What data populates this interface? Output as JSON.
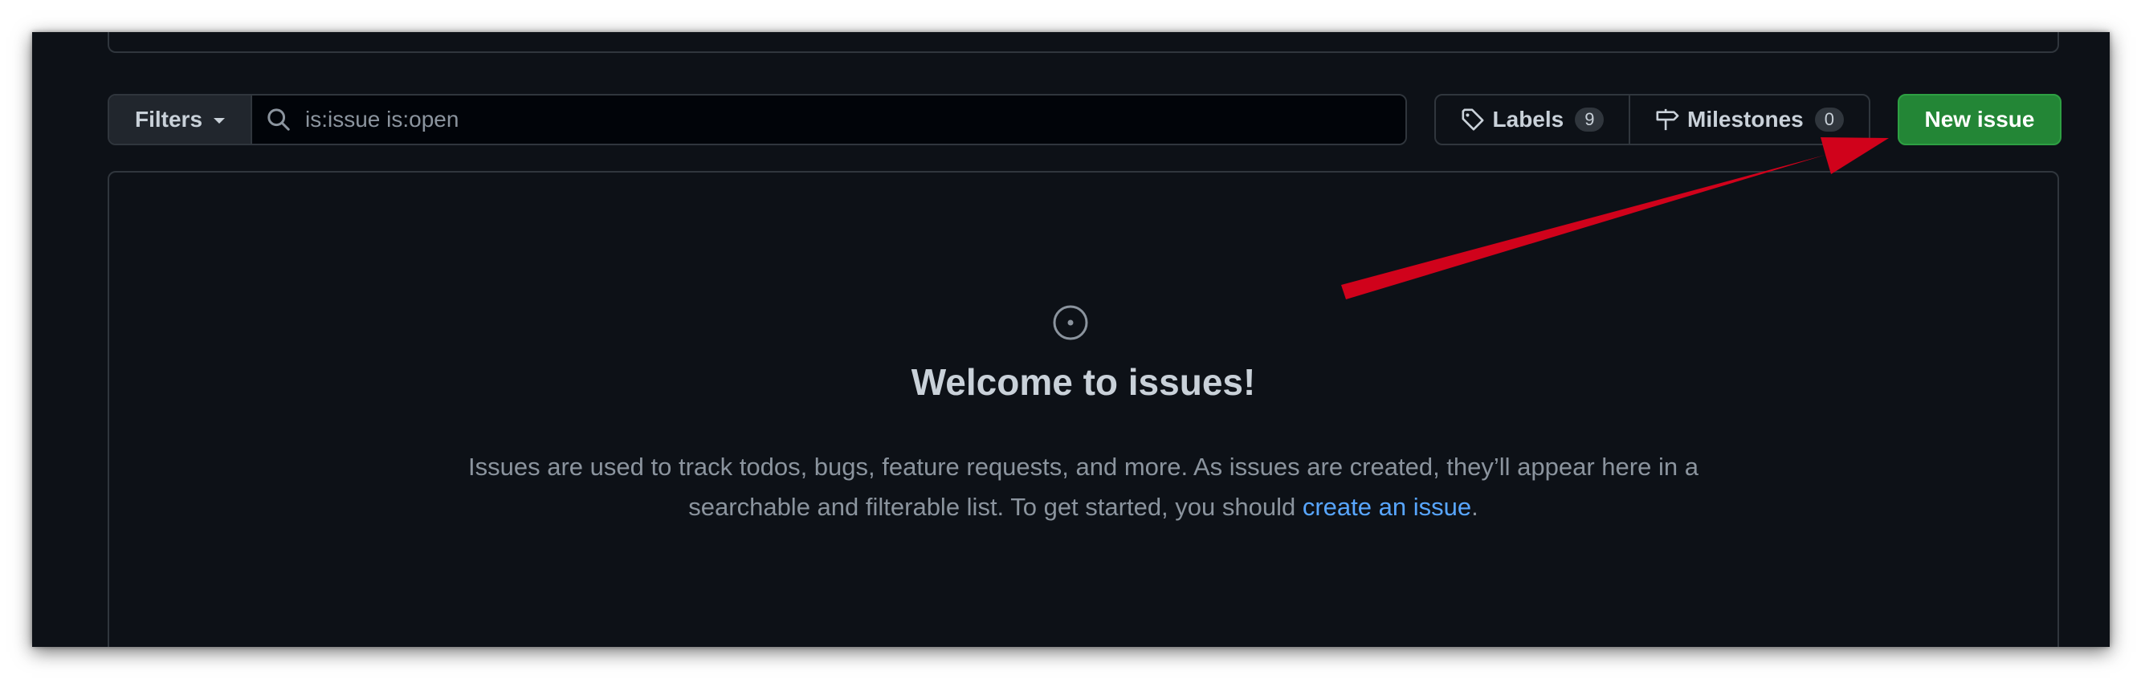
{
  "search": {
    "value": "is:issue is:open"
  },
  "subnav": {
    "filters_label": "Filters",
    "labels_label": "Labels",
    "labels_count": "9",
    "milestones_label": "Milestones",
    "milestones_count": "0",
    "new_issue_label": "New issue"
  },
  "blankslate": {
    "title": "Welcome to issues!",
    "text_before": "Issues are used to track todos, bugs, feature requests, and more. As issues are created, they’ll appear here in a searchable and filterable list. To get started, you should ",
    "link_text": "create an issue",
    "text_after": "."
  },
  "colors": {
    "background": "#0d1117",
    "border": "#30363d",
    "primary_button": "#238636",
    "link": "#58a6ff",
    "annotation_arrow": "#d0021b"
  },
  "icons": [
    "search-icon",
    "tag-icon",
    "milestone-icon",
    "issue-opened-icon",
    "caret-down-icon"
  ]
}
